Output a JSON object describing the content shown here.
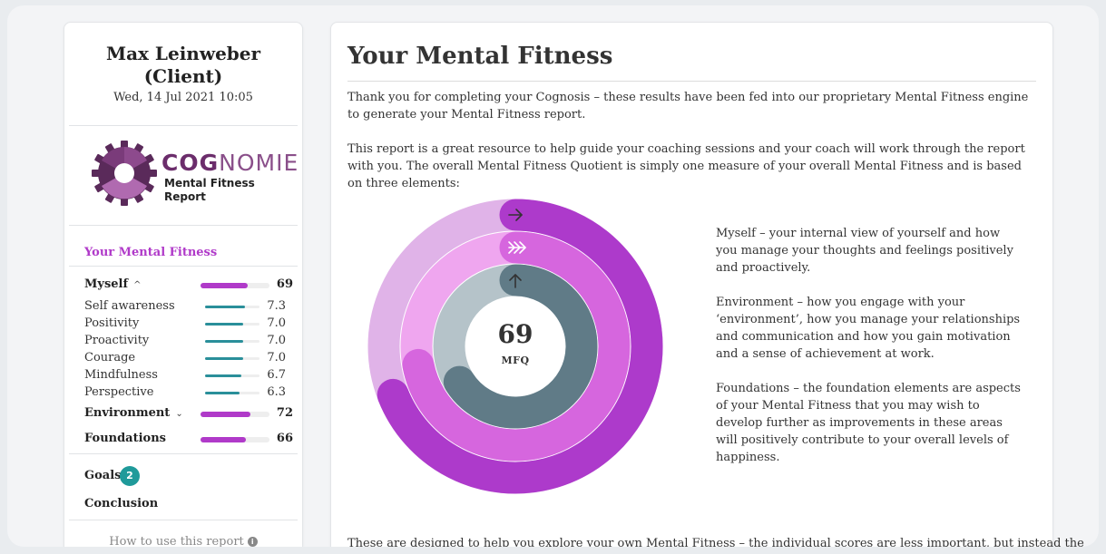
{
  "sidebar": {
    "client_name": "Max Leinweber (Client)",
    "date": "Wed, 14 Jul 2021 10:05",
    "logo": {
      "word_bold": "COG",
      "word_light": "NOMIE",
      "subtitle_line1": "Mental Fitness",
      "subtitle_line2": "Report"
    },
    "active_section": "Your Mental Fitness",
    "sections": [
      {
        "label": "Myself",
        "score": 69,
        "chevron": "^"
      },
      {
        "label": "Environment",
        "score": 72,
        "chevron": "⌄"
      },
      {
        "label": "Foundations",
        "score": 66
      }
    ],
    "myself_items": [
      {
        "label": "Self awareness",
        "value": "7.3"
      },
      {
        "label": "Positivity",
        "value": "7.0"
      },
      {
        "label": "Proactivity",
        "value": "7.0"
      },
      {
        "label": "Courage",
        "value": "7.0"
      },
      {
        "label": "Mindfulness",
        "value": "6.7"
      },
      {
        "label": "Perspective",
        "value": "6.3"
      }
    ],
    "goals_label": "Goals",
    "goals_count": "2",
    "conclusion_label": "Conclusion",
    "how_to_label": "How to use this report"
  },
  "main": {
    "title": "Your Mental Fitness",
    "intro": "Thank you for completing your Cognosis – these results have been fed into our proprietary Mental Fitness engine to generate your Mental Fitness report.",
    "overview": "This report is a great resource to help guide your coaching sessions and your coach will work through the report with you. The overall Mental Fitness Quotient is simply one measure of your overall Mental Fitness and is based on three elements:",
    "mfq_value": "69",
    "mfq_label": "MFQ",
    "elements": [
      "Myself – your internal view of yourself and how you manage your thoughts and feelings positively and proactively.",
      "Environment – how you engage with your ‘environment’, how you manage your relationships and communication and how you gain motivation and a sense of achievement at work.",
      "Foundations – the foundation elements are aspects of your Mental Fitness that you may wish to develop further as improvements in these areas will positively contribute to your overall levels of happiness."
    ],
    "footer_text": "These are designed to help you explore your own Mental Fitness – the individual scores are less important, but instead the"
  },
  "colors": {
    "accent_purple": "#b03ac9",
    "teal": "#2a8f9a",
    "ring_outer": "#ad3acb",
    "ring_middle": "#d666de",
    "ring_inner": "#607b87"
  }
}
